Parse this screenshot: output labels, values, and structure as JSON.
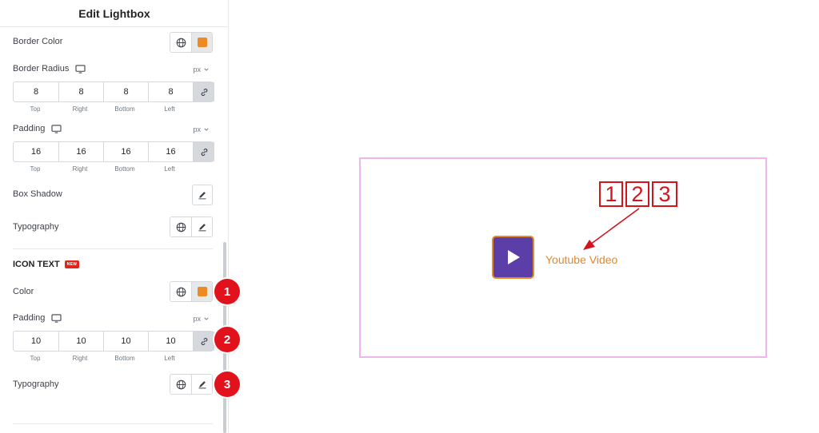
{
  "panel": {
    "title": "Edit Lightbox",
    "border_color_label": "Border Color",
    "border_color_swatch": "#ec8a23",
    "border_radius_label": "Border Radius",
    "border_radius_unit": "px",
    "border_radius_values": [
      "8",
      "8",
      "8",
      "8"
    ],
    "dimension_labels": [
      "Top",
      "Right",
      "Bottom",
      "Left"
    ],
    "padding_label": "Padding",
    "padding_unit": "px",
    "padding_values": [
      "16",
      "16",
      "16",
      "16"
    ],
    "box_shadow_label": "Box Shadow",
    "typography_label": "Typography"
  },
  "icon_text_section": {
    "title": "ICON TEXT",
    "badge": "NEW",
    "color_label": "Color",
    "color_swatch": "#ec8a23",
    "padding_label": "Padding",
    "padding_unit": "px",
    "padding_values": [
      "10",
      "10",
      "10",
      "10"
    ],
    "typography_label": "Typography"
  },
  "markers": [
    "1",
    "2",
    "3"
  ],
  "preview": {
    "video_text": "Youtube Video",
    "play_button_color": "#5b3ea7",
    "callout_numbers": [
      "1",
      "2",
      "3"
    ]
  },
  "icons": [
    "globe-icon",
    "pencil-icon",
    "link-icon",
    "monitor-icon",
    "chevron-down-icon",
    "play-icon"
  ]
}
